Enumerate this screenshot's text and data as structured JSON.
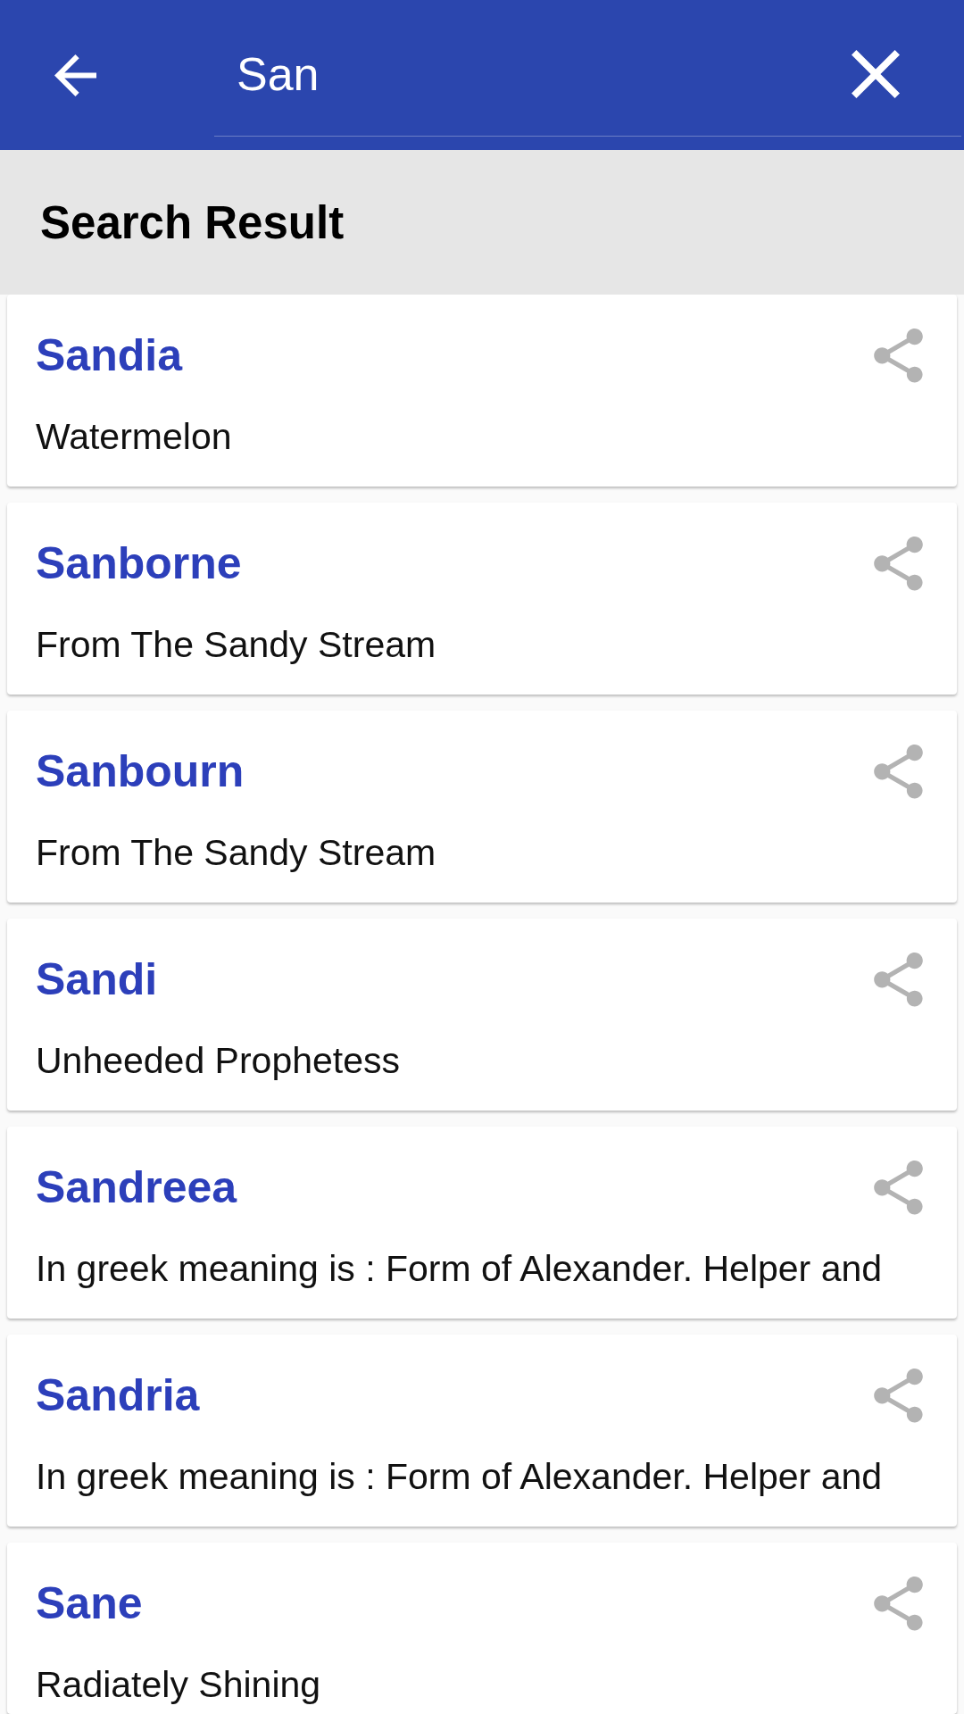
{
  "toolbar": {
    "search": {
      "value": "San"
    }
  },
  "header": {
    "title": "Search Result"
  },
  "results": [
    {
      "name": "Sandia",
      "meaning": "Watermelon"
    },
    {
      "name": "Sanborne",
      "meaning": "From The Sandy Stream"
    },
    {
      "name": "Sanbourn",
      "meaning": "From The Sandy Stream"
    },
    {
      "name": "Sandi",
      "meaning": "Unheeded Prophetess"
    },
    {
      "name": "Sandreea",
      "meaning": "In greek meaning is : Form of Alexander. Helper and"
    },
    {
      "name": "Sandria",
      "meaning": "In greek meaning is : Form of Alexander. Helper and"
    },
    {
      "name": "Sane",
      "meaning": "Radiately Shining"
    }
  ]
}
